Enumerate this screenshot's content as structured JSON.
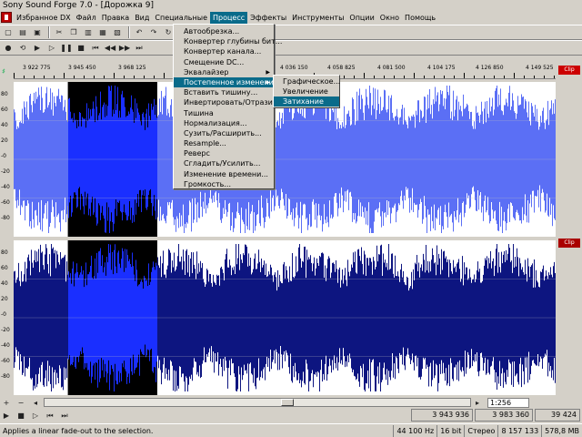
{
  "window": {
    "title": "Sony Sound Forge 7.0 - [Дорожка 9]"
  },
  "menu": [
    {
      "label": "Избранное DX",
      "active": false
    },
    {
      "label": "Файл",
      "active": false
    },
    {
      "label": "Правка",
      "active": false
    },
    {
      "label": "Вид",
      "active": false
    },
    {
      "label": "Специальные",
      "active": false
    },
    {
      "label": "Процесс",
      "active": true
    },
    {
      "label": "Эффекты",
      "active": false
    },
    {
      "label": "Инструменты",
      "active": false
    },
    {
      "label": "Опции",
      "active": false
    },
    {
      "label": "Окно",
      "active": false
    },
    {
      "label": "Помощь",
      "active": false
    }
  ],
  "process_menu": [
    {
      "label": "Автообрезка...",
      "submenu": false
    },
    {
      "label": "Конвертер глубины бит...",
      "submenu": false
    },
    {
      "label": "Конвертер канала...",
      "submenu": false
    },
    {
      "label": "Смещение DC...",
      "submenu": false
    },
    {
      "label": "Эквалайзер",
      "submenu": true
    },
    {
      "label": "Постепенное изменение",
      "submenu": true,
      "highlighted": true
    },
    {
      "label": "Вставить тишину...",
      "submenu": false
    },
    {
      "label": "Инвертировать/Отразить",
      "submenu": false
    },
    {
      "label": "Тишина",
      "submenu": false
    },
    {
      "label": "Нормализация...",
      "submenu": false
    },
    {
      "label": "Сузить/Расширить...",
      "submenu": false
    },
    {
      "label": "Resample...",
      "submenu": false
    },
    {
      "label": "Реверс",
      "submenu": false
    },
    {
      "label": "Сгладить/Усилить...",
      "submenu": false
    },
    {
      "label": "Изменение времени...",
      "submenu": false
    },
    {
      "label": "Громкость...",
      "submenu": false
    }
  ],
  "fade_submenu": [
    {
      "label": "Графическое...",
      "highlighted": false
    },
    {
      "label": "Увеличение",
      "highlighted": false
    },
    {
      "label": "Затихание",
      "highlighted": true
    }
  ],
  "ruler": {
    "labels": [
      "3 922 775",
      "3 945 450",
      "3 968 125",
      "4 036 150",
      "4 058 825",
      "4 081 500",
      "4 104 175",
      "4 126 850",
      "4 149 525"
    ]
  },
  "yaxis_labels": [
    "80",
    "60",
    "40",
    "20",
    "-0",
    "-20",
    "-40",
    "-60",
    "-80"
  ],
  "clip_label": "Clip",
  "selection_start_frac": 0.1,
  "selection_end_frac": 0.265,
  "zoom": "1:256",
  "positions": {
    "start": "3 943 936",
    "end": "3 983 360",
    "length": "39 424"
  },
  "status": {
    "hint": "Applies a linear fade-out to the selection.",
    "sample_rate": "44 100 Hz",
    "bit_depth": "16 bit",
    "channels": "Стерео",
    "samples": "8 157 133",
    "memory": "578,8 MB"
  },
  "colors": {
    "wave_light": "#5b6ff5",
    "wave_dark": "#0d1580",
    "selection_bg": "#000000",
    "selection_wave": "#1a2fff",
    "menu_highlight": "#0a6b8a"
  }
}
